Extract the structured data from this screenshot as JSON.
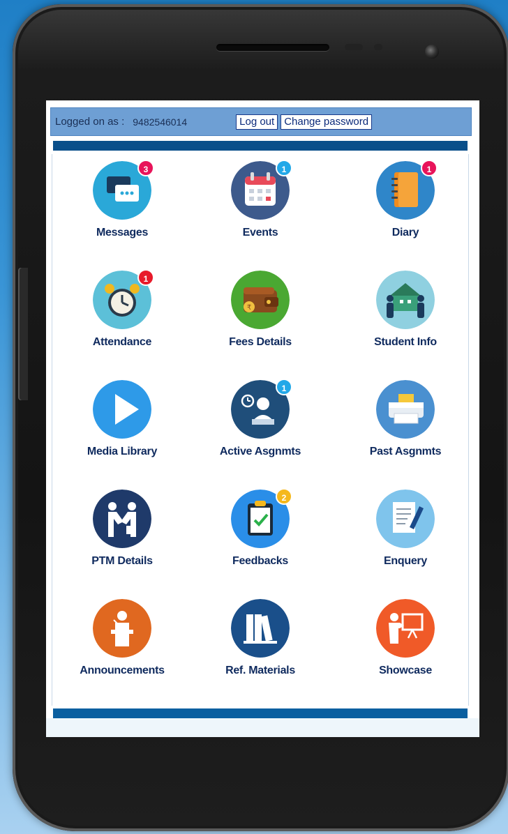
{
  "header": {
    "logged_label": "Logged on as :",
    "user_id": "9482546014",
    "logout_label": "Log out",
    "change_password_label": "Change password"
  },
  "tiles": [
    {
      "label": "Messages",
      "icon": "chat-bubbles-icon",
      "badge": "3",
      "badge_color": "#e8145a",
      "bg": "#2aa8d8"
    },
    {
      "label": "Events",
      "icon": "calendar-icon",
      "badge": "1",
      "badge_color": "#22a8e8",
      "bg": "#3d5a8c"
    },
    {
      "label": "Diary",
      "icon": "notebook-icon",
      "badge": "1",
      "badge_color": "#e8145a",
      "bg": "#2f86c9"
    },
    {
      "label": "Attendance",
      "icon": "alarm-clock-icon",
      "badge": "1",
      "badge_color": "#e81a2a",
      "bg": "#5cc0d8"
    },
    {
      "label": "Fees Details",
      "icon": "wallet-icon",
      "badge": "",
      "badge_color": "",
      "bg": "#4aa832"
    },
    {
      "label": "Student Info",
      "icon": "family-house-icon",
      "badge": "",
      "badge_color": "",
      "bg": "#8fd0e0"
    },
    {
      "label": "Media Library",
      "icon": "play-icon",
      "badge": "",
      "badge_color": "",
      "bg": "#2e9ae8"
    },
    {
      "label": "Active Asgnmts",
      "icon": "person-laptop-icon",
      "badge": "1",
      "badge_color": "#22a8e8",
      "bg": "#1f4e7a"
    },
    {
      "label": "Past Asgnmts",
      "icon": "printer-icon",
      "badge": "",
      "badge_color": "",
      "bg": "#4a90d0"
    },
    {
      "label": "PTM Details",
      "icon": "handshake-icon",
      "badge": "",
      "badge_color": "",
      "bg": "#1f3a6a"
    },
    {
      "label": "Feedbacks",
      "icon": "clipboard-check-icon",
      "badge": "2",
      "badge_color": "#f5b81c",
      "bg": "#2a8ee8"
    },
    {
      "label": "Enquery",
      "icon": "document-pen-icon",
      "badge": "",
      "badge_color": "",
      "bg": "#7fc4ec"
    },
    {
      "label": "Announcements",
      "icon": "podium-speaker-icon",
      "badge": "",
      "badge_color": "",
      "bg": "#e06820"
    },
    {
      "label": "Ref. Materials",
      "icon": "books-icon",
      "badge": "",
      "badge_color": "",
      "bg": "#1a4f8a"
    },
    {
      "label": "Showcase",
      "icon": "presentation-board-icon",
      "badge": "",
      "badge_color": "",
      "bg": "#f05a28"
    }
  ]
}
